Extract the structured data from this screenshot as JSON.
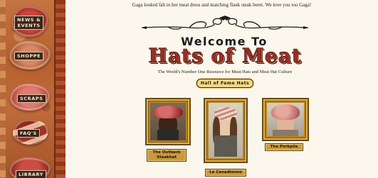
{
  "announcement": "Gaga looked fab in her meat dress and matching flank steak beret. We love you too Gaga!",
  "nav": [
    {
      "label_line1": "News &",
      "label_line2": "Events"
    },
    {
      "label_line1": "Shoppe",
      "label_line2": ""
    },
    {
      "label_line1": "Scraps",
      "label_line2": ""
    },
    {
      "label_line1": "FAQ'S",
      "label_line2": ""
    },
    {
      "label_line1": "Library",
      "label_line2": ""
    }
  ],
  "welcome": "Welcome To",
  "site_title": "Hats of Meat",
  "tagline": "The World's Number One Resource for Meat Hats and Meat Hat Culture",
  "hall_of_fame_label": "Hall of Fame Hats",
  "hats": [
    {
      "name_line1": "The Outback",
      "name_line2": "Steakhat"
    },
    {
      "name_line1": "Le Canadienne",
      "name_line2": ""
    },
    {
      "name_line1": "The Porkpile",
      "name_line2": ""
    }
  ],
  "colors": {
    "title_red": "#9b2c26",
    "page_background": "#fbf7ec",
    "frame_gold": "#b7831f"
  }
}
